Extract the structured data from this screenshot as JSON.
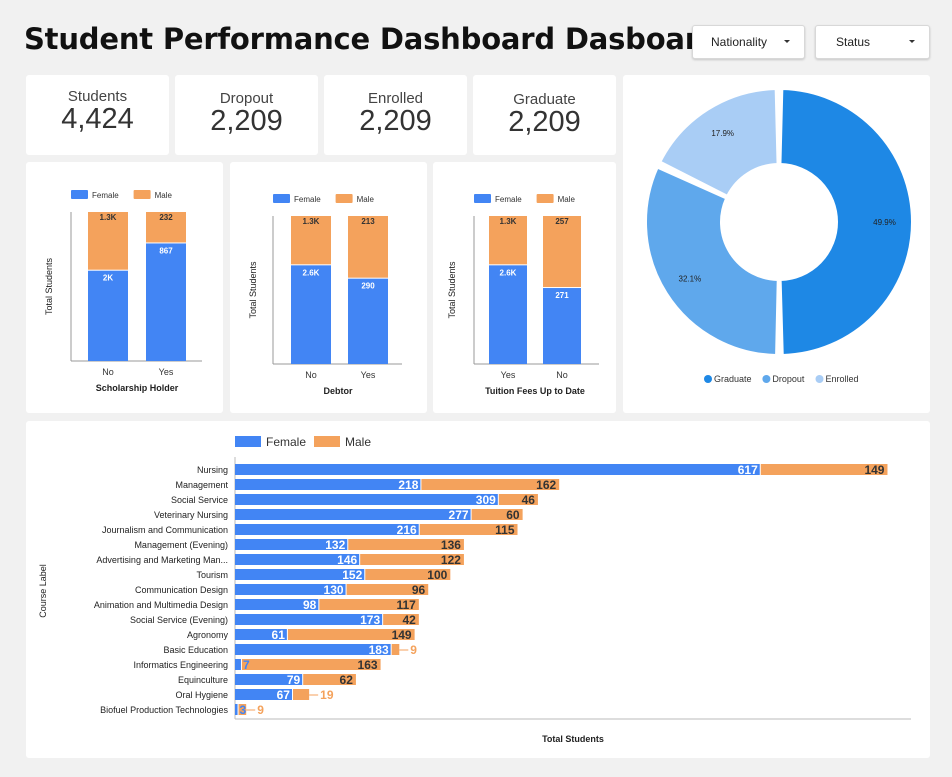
{
  "header": {
    "title": "Student Performance Dashboard Dasboard",
    "filters": [
      {
        "label": "Nationality"
      },
      {
        "label": "Status"
      }
    ]
  },
  "kpis": [
    {
      "label": "Students",
      "value": "4,424"
    },
    {
      "label": "Dropout",
      "value": "2,209"
    },
    {
      "label": "Enrolled",
      "value": "2,209"
    },
    {
      "label": "Graduate",
      "value": "2,209"
    }
  ],
  "colors": {
    "female": "#4285f4",
    "male": "#f4a25c",
    "graduate": "#1e88e5",
    "dropout": "#5fa8ec",
    "enrolled": "#a9cdf5"
  },
  "chart_data": [
    {
      "type": "bar",
      "stacked": true,
      "ylabel": "Total Students",
      "xlabel": "Scholarship Holder",
      "categories": [
        "No",
        "Yes"
      ],
      "series": [
        {
          "name": "Female",
          "values": [
            2000,
            867
          ],
          "labels": [
            "2K",
            "867"
          ]
        },
        {
          "name": "Male",
          "values": [
            1300,
            232
          ],
          "labels": [
            "1.3K",
            "232"
          ]
        }
      ],
      "legend": "top-left"
    },
    {
      "type": "bar",
      "stacked": true,
      "ylabel": "Total Students",
      "xlabel": "Debtor",
      "categories": [
        "No",
        "Yes"
      ],
      "series": [
        {
          "name": "Female",
          "values": [
            2600,
            290
          ],
          "labels": [
            "2.6K",
            "290"
          ]
        },
        {
          "name": "Male",
          "values": [
            1300,
            213
          ],
          "labels": [
            "1.3K",
            "213"
          ]
        }
      ],
      "legend": "top-left"
    },
    {
      "type": "bar",
      "stacked": true,
      "ylabel": "Total Students",
      "xlabel": "Tuition Fees Up to Date",
      "categories": [
        "Yes",
        "No"
      ],
      "series": [
        {
          "name": "Female",
          "values": [
            2600,
            271
          ],
          "labels": [
            "2.6K",
            "271"
          ]
        },
        {
          "name": "Male",
          "values": [
            1300,
            257
          ],
          "labels": [
            "1.3K",
            "257"
          ]
        }
      ],
      "legend": "top-left"
    },
    {
      "type": "pie",
      "donut": true,
      "slices": [
        {
          "name": "Graduate",
          "value": 49.9,
          "label": "49.9%"
        },
        {
          "name": "Dropout",
          "value": 32.1,
          "label": "32.1%"
        },
        {
          "name": "Enrolled",
          "value": 17.9,
          "label": "17.9%"
        }
      ],
      "legend": "bottom"
    },
    {
      "type": "bar",
      "orientation": "horizontal",
      "stacked": true,
      "ylabel": "Course Label",
      "xlabel": "Total Students",
      "categories": [
        "Nursing",
        "Management",
        "Social Service",
        "Veterinary Nursing",
        "Journalism and Communication",
        "Management (Evening)",
        "Advertising and Marketing Man...",
        "Tourism",
        "Communication Design",
        "Animation and Multimedia Design",
        "Social Service (Evening)",
        "Agronomy",
        "Basic Education",
        "Informatics Engineering",
        "Equinculture",
        "Oral Hygiene",
        "Biofuel Production Technologies"
      ],
      "series": [
        {
          "name": "Female",
          "values": [
            617,
            218,
            309,
            277,
            216,
            132,
            146,
            152,
            130,
            98,
            173,
            61,
            183,
            7,
            79,
            67,
            3
          ]
        },
        {
          "name": "Male",
          "values": [
            149,
            162,
            46,
            60,
            115,
            136,
            122,
            100,
            96,
            117,
            42,
            149,
            9,
            163,
            62,
            19,
            9
          ]
        }
      ],
      "legend": "top-left"
    }
  ]
}
